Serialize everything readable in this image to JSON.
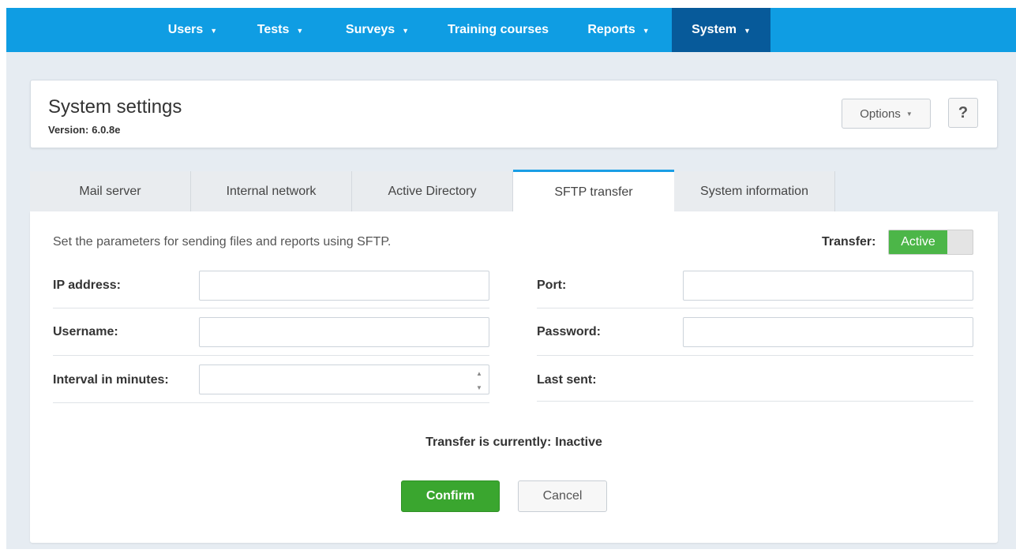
{
  "nav": {
    "items": [
      {
        "label": "Users",
        "dropdown": true
      },
      {
        "label": "Tests",
        "dropdown": true
      },
      {
        "label": "Surveys",
        "dropdown": true
      },
      {
        "label": "Training courses",
        "dropdown": false
      },
      {
        "label": "Reports",
        "dropdown": true
      },
      {
        "label": "System",
        "dropdown": true,
        "active": true
      }
    ],
    "caret": "▼"
  },
  "header": {
    "title": "System settings",
    "version_label": "Version:",
    "version_value": "6.0.8e",
    "options_label": "Options",
    "help_label": "?"
  },
  "tabs": [
    {
      "label": "Mail server"
    },
    {
      "label": "Internal network"
    },
    {
      "label": "Active Directory"
    },
    {
      "label": "SFTP transfer",
      "active": true
    },
    {
      "label": "System information"
    }
  ],
  "sftp": {
    "description": "Set the parameters for sending files and reports using SFTP.",
    "transfer_label": "Transfer:",
    "toggle_label": "Active",
    "fields": {
      "ip_address": {
        "label": "IP address:",
        "value": ""
      },
      "port": {
        "label": "Port:",
        "value": ""
      },
      "username": {
        "label": "Username:",
        "value": ""
      },
      "password": {
        "label": "Password:",
        "value": ""
      },
      "interval": {
        "label": "Interval in minutes:",
        "value": ""
      },
      "last_sent": {
        "label": "Last sent:",
        "value": ""
      }
    },
    "status_prefix": "Transfer is currently:",
    "status_value": "Inactive",
    "confirm_label": "Confirm",
    "cancel_label": "Cancel"
  },
  "colors": {
    "nav_bg": "#0f9de3",
    "nav_active": "#075a9a",
    "toggle_active": "#4cb648",
    "confirm": "#3aa62f",
    "tab_accent": "#1a9ee5"
  },
  "icons": {
    "caret": "caret-down-icon",
    "help": "question-icon",
    "spin_up": "spin-up-icon",
    "spin_down": "spin-down-icon"
  }
}
